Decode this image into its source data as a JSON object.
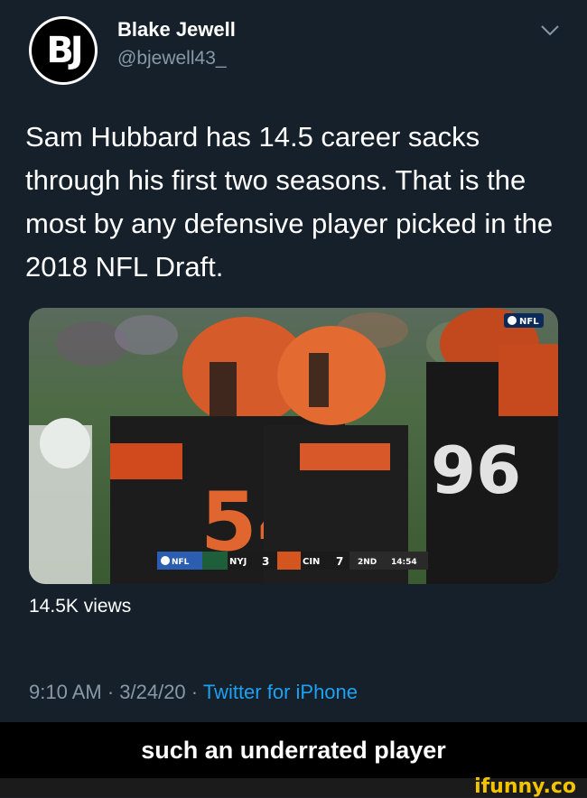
{
  "tweet": {
    "author_name": "Blake Jewell",
    "author_handle": "@bjewell43_",
    "avatar_text": "BJ",
    "text": "Sam Hubbard has 14.5 career sacks through his first two seasons. That is the most by any defensive player picked in the 2018 NFL Draft.",
    "views": "14.5K views",
    "timestamp": "9:10 AM · 3/24/20 · ",
    "source": "Twitter for iPhone"
  },
  "video": {
    "network_bug": "NFL",
    "scoreboard": {
      "league": "NFL",
      "away_team": "NYJ",
      "away_score": "3",
      "home_team": "CIN",
      "home_score": "7",
      "quarter": "2ND",
      "clock": "14:54"
    },
    "jersey_numbers": [
      "54",
      "96"
    ]
  },
  "caption": "such an underrated player",
  "watermark": "ifunny.co",
  "colors": {
    "background": "#15202b",
    "secondary_text": "#8899a6",
    "link": "#1da1f2",
    "bengals_orange": "#fb4f14",
    "watermark": "#f4c300"
  }
}
